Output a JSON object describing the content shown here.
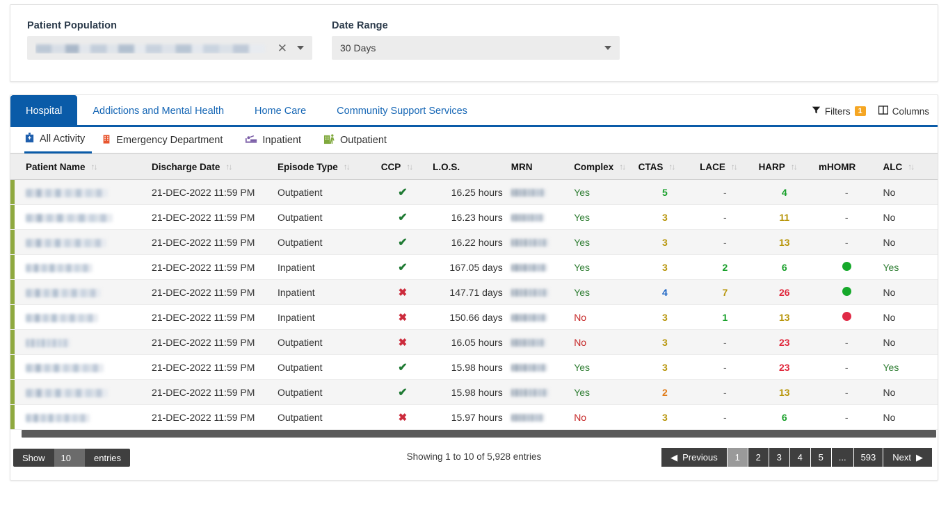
{
  "filters": {
    "patient_population": {
      "label": "Patient Population",
      "value_redacted": true,
      "clear_icon": "close-icon",
      "dropdown_icon": "chevron-down-icon"
    },
    "date_range": {
      "label": "Date Range",
      "value": "30 Days",
      "dropdown_icon": "chevron-down-icon"
    }
  },
  "tabs": [
    {
      "label": "Hospital",
      "active": true
    },
    {
      "label": "Addictions and Mental Health",
      "active": false
    },
    {
      "label": "Home Care",
      "active": false
    },
    {
      "label": "Community Support Services",
      "active": false
    }
  ],
  "tab_actions": {
    "filters_label": "Filters",
    "filters_count": "1",
    "filters_icon": "funnel-icon",
    "columns_label": "Columns",
    "columns_icon": "columns-icon"
  },
  "subtabs": [
    {
      "label": "All Activity",
      "icon": "hospital-icon",
      "color": "#1f5fad",
      "active": true
    },
    {
      "label": "Emergency Department",
      "icon": "emergency-hospital-icon",
      "color": "#e8552e",
      "active": false
    },
    {
      "label": "Inpatient",
      "icon": "bed-icon",
      "color": "#7b5ea7",
      "active": false
    },
    {
      "label": "Outpatient",
      "icon": "outpatient-icon",
      "color": "#7fa83c",
      "active": false
    }
  ],
  "table": {
    "columns": [
      {
        "key": "patient_name",
        "label": "Patient Name",
        "sortable": true,
        "align": "left"
      },
      {
        "key": "discharge_date",
        "label": "Discharge Date",
        "sortable": true,
        "align": "left"
      },
      {
        "key": "episode_type",
        "label": "Episode Type",
        "sortable": true,
        "align": "left"
      },
      {
        "key": "ccp",
        "label": "CCP",
        "sortable": true,
        "align": "center"
      },
      {
        "key": "los",
        "label": "L.O.S.",
        "sortable": false,
        "align": "right"
      },
      {
        "key": "mrn",
        "label": "MRN",
        "sortable": false,
        "align": "left"
      },
      {
        "key": "complex",
        "label": "Complex",
        "sortable": true,
        "align": "left"
      },
      {
        "key": "ctas",
        "label": "CTAS",
        "sortable": true,
        "align": "center"
      },
      {
        "key": "lace",
        "label": "LACE",
        "sortable": true,
        "align": "center"
      },
      {
        "key": "harp",
        "label": "HARP",
        "sortable": true,
        "align": "center"
      },
      {
        "key": "mhomr",
        "label": "mHOMR",
        "sortable": false,
        "align": "center"
      },
      {
        "key": "alc",
        "label": "ALC",
        "sortable": true,
        "align": "left"
      }
    ],
    "sort_icon": "sort-updown-icon",
    "rows": [
      {
        "patient_name": "",
        "name_redacted": true,
        "name_width": 118,
        "discharge_date": "21-DEC-2022 11:59 PM",
        "episode_type": "Outpatient",
        "ccp": "check",
        "los": "16.25 hours",
        "mrn_redacted": true,
        "mrn_width": 50,
        "complex": "Yes",
        "ctas": "5",
        "ctas_color": "green",
        "lace": "-",
        "lace_color": "dash",
        "harp": "4",
        "harp_color": "green",
        "mhomr": "-",
        "alc": "No"
      },
      {
        "patient_name": "",
        "name_redacted": true,
        "name_width": 125,
        "discharge_date": "21-DEC-2022 11:59 PM",
        "episode_type": "Outpatient",
        "ccp": "check",
        "los": "16.23 hours",
        "mrn_redacted": true,
        "mrn_width": 48,
        "complex": "Yes",
        "ctas": "3",
        "ctas_color": "amber",
        "lace": "-",
        "lace_color": "dash",
        "harp": "11",
        "harp_color": "amber",
        "mhomr": "-",
        "alc": "No"
      },
      {
        "patient_name": "",
        "name_redacted": true,
        "name_width": 116,
        "discharge_date": "21-DEC-2022 11:59 PM",
        "episode_type": "Outpatient",
        "ccp": "check",
        "los": "16.22 hours",
        "mrn_redacted": true,
        "mrn_width": 54,
        "complex": "Yes",
        "ctas": "3",
        "ctas_color": "amber",
        "lace": "-",
        "lace_color": "dash",
        "harp": "13",
        "harp_color": "amber",
        "mhomr": "-",
        "alc": "No"
      },
      {
        "patient_name": "",
        "name_redacted": true,
        "name_width": 96,
        "discharge_date": "21-DEC-2022 11:59 PM",
        "episode_type": "Inpatient",
        "ccp": "check",
        "los": "167.05 days",
        "mrn_redacted": true,
        "mrn_width": 52,
        "complex": "Yes",
        "ctas": "3",
        "ctas_color": "amber",
        "lace": "2",
        "lace_color": "green",
        "harp": "6",
        "harp_color": "green",
        "mhomr": "green",
        "alc": "Yes"
      },
      {
        "patient_name": "",
        "name_redacted": true,
        "name_width": 108,
        "discharge_date": "21-DEC-2022 11:59 PM",
        "episode_type": "Inpatient",
        "ccp": "cross",
        "los": "147.71 days",
        "mrn_redacted": true,
        "mrn_width": 54,
        "complex": "Yes",
        "ctas": "4",
        "ctas_color": "blue",
        "lace": "7",
        "lace_color": "amber",
        "harp": "26",
        "harp_color": "red",
        "mhomr": "green",
        "alc": "No"
      },
      {
        "patient_name": "",
        "name_redacted": true,
        "name_width": 104,
        "discharge_date": "21-DEC-2022 11:59 PM",
        "episode_type": "Inpatient",
        "ccp": "cross",
        "los": "150.66 days",
        "mrn_redacted": true,
        "mrn_width": 52,
        "complex": "No",
        "ctas": "3",
        "ctas_color": "amber",
        "lace": "1",
        "lace_color": "green",
        "harp": "13",
        "harp_color": "amber",
        "mhomr": "red",
        "alc": "No"
      },
      {
        "patient_name": "",
        "name_redacted": true,
        "name_width": 64,
        "discharge_date": "21-DEC-2022 11:59 PM",
        "episode_type": "Outpatient",
        "ccp": "cross",
        "los": "16.05 hours",
        "mrn_redacted": true,
        "mrn_width": 50,
        "complex": "No",
        "ctas": "3",
        "ctas_color": "amber",
        "lace": "-",
        "lace_color": "dash",
        "harp": "23",
        "harp_color": "red",
        "mhomr": "-",
        "alc": "No"
      },
      {
        "patient_name": "",
        "name_redacted": true,
        "name_width": 112,
        "discharge_date": "21-DEC-2022 11:59 PM",
        "episode_type": "Outpatient",
        "ccp": "check",
        "los": "15.98 hours",
        "mrn_redacted": true,
        "mrn_width": 52,
        "complex": "Yes",
        "ctas": "3",
        "ctas_color": "amber",
        "lace": "-",
        "lace_color": "dash",
        "harp": "23",
        "harp_color": "red",
        "mhomr": "-",
        "alc": "Yes"
      },
      {
        "patient_name": "",
        "name_redacted": true,
        "name_width": 118,
        "discharge_date": "21-DEC-2022 11:59 PM",
        "episode_type": "Outpatient",
        "ccp": "check",
        "los": "15.98 hours",
        "mrn_redacted": true,
        "mrn_width": 54,
        "complex": "Yes",
        "ctas": "2",
        "ctas_color": "orange",
        "lace": "-",
        "lace_color": "dash",
        "harp": "13",
        "harp_color": "amber",
        "mhomr": "-",
        "alc": "No"
      },
      {
        "patient_name": "",
        "name_redacted": true,
        "name_width": 92,
        "discharge_date": "21-DEC-2022 11:59 PM",
        "episode_type": "Outpatient",
        "ccp": "cross",
        "los": "15.97 hours",
        "mrn_redacted": true,
        "mrn_width": 48,
        "complex": "No",
        "ctas": "3",
        "ctas_color": "amber",
        "lace": "-",
        "lace_color": "dash",
        "harp": "6",
        "harp_color": "green",
        "mhomr": "-",
        "alc": "No"
      }
    ]
  },
  "footer": {
    "show_label": "Show",
    "page_size": "10",
    "entries_label": "entries",
    "showing_text": "Showing 1 to 10 of 5,928 entries",
    "pagination": {
      "previous_label": "Previous",
      "previous_icon": "caret-left-icon",
      "next_label": "Next",
      "next_icon": "caret-right-icon",
      "pages": [
        "1",
        "2",
        "3",
        "4",
        "5",
        "...",
        "593"
      ],
      "active_page": "1"
    }
  },
  "colors": {
    "brand_blue": "#0a5ba8",
    "accent_olive": "#8fa93f",
    "badge_orange": "#f5a623",
    "good_green": "#18a02a",
    "warn_amber": "#b8960c",
    "bad_red": "#e0283c"
  }
}
